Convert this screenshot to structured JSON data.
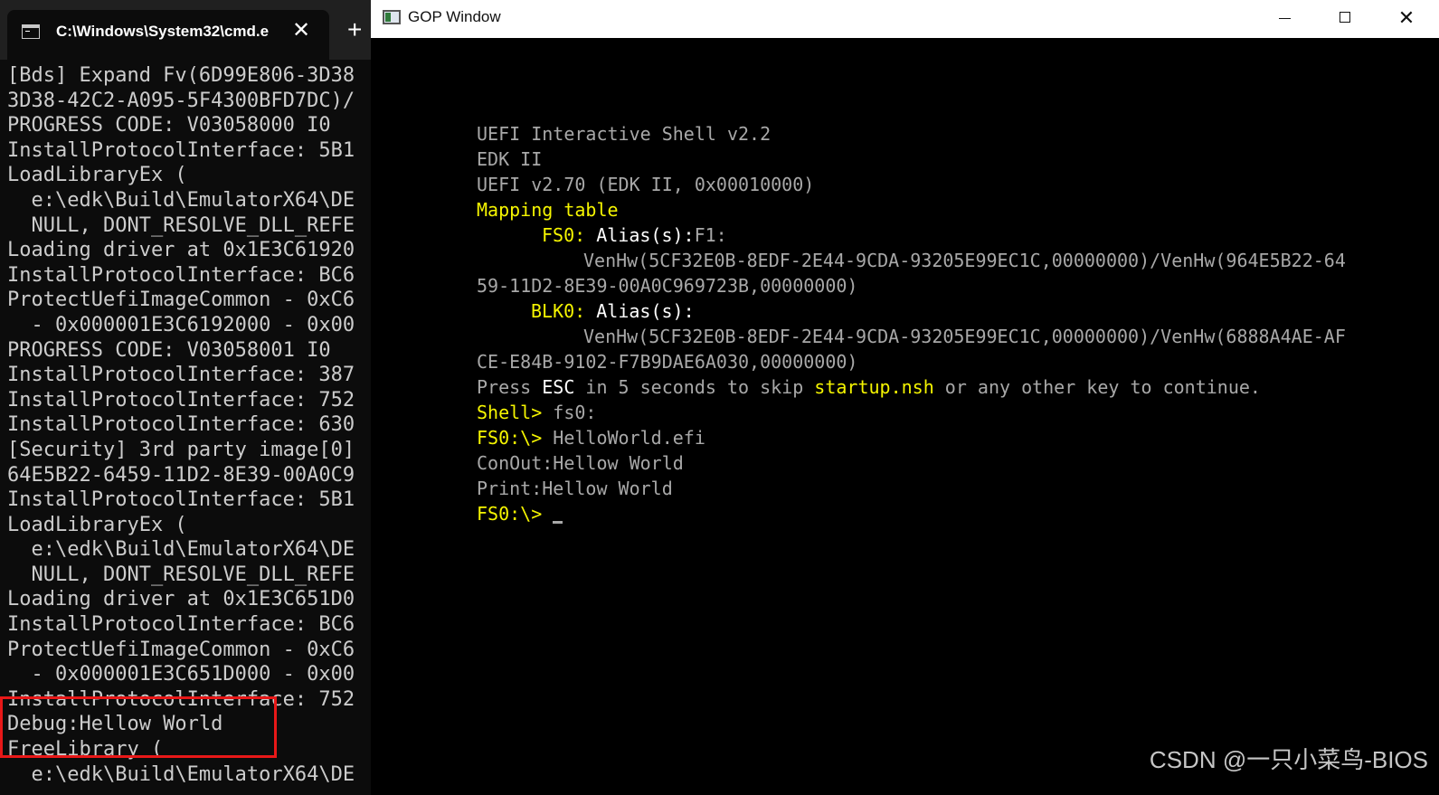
{
  "cmd_window": {
    "tab_title": "C:\\Windows\\System32\\cmd.e",
    "close_glyph": "✕",
    "new_tab_glyph": "+",
    "lines": [
      "[Bds] Expand Fv(6D99E806-3D38",
      "3D38-42C2-A095-5F4300BFD7DC)/",
      "PROGRESS CODE: V03058000 I0",
      "InstallProtocolInterface: 5B1",
      "LoadLibraryEx (",
      "  e:\\edk\\Build\\EmulatorX64\\DE",
      "  NULL, DONT_RESOLVE_DLL_REFE",
      "Loading driver at 0x1E3C61920",
      "InstallProtocolInterface: BC6",
      "ProtectUefiImageCommon - 0xC6",
      "  - 0x000001E3C6192000 - 0x00",
      "PROGRESS CODE: V03058001 I0",
      "InstallProtocolInterface: 387",
      "InstallProtocolInterface: 752",
      "InstallProtocolInterface: 630",
      "[Security] 3rd party image[0]",
      "64E5B22-6459-11D2-8E39-00A0C9",
      "InstallProtocolInterface: 5B1",
      "LoadLibraryEx (",
      "  e:\\edk\\Build\\EmulatorX64\\DE",
      "  NULL, DONT_RESOLVE_DLL_REFE",
      "Loading driver at 0x1E3C651D0",
      "InstallProtocolInterface: BC6",
      "ProtectUefiImageCommon - 0xC6",
      "  - 0x000001E3C651D000 - 0x00",
      "InstallProtocolInterface: 752",
      "Debug:Hellow World",
      "FreeLibrary (",
      "  e:\\edk\\Build\\EmulatorX64\\DE"
    ]
  },
  "gop_window": {
    "title": "GOP Window",
    "close_glyph": "✕",
    "shell": {
      "banner_1": "UEFI Interactive Shell v2.2",
      "banner_2": "EDK II",
      "banner_3": "UEFI v2.70 (EDK II, 0x00010000)",
      "mapping_title": "Mapping table",
      "fs0_label": "FS0:",
      "fs0_alias": "Alias(s):",
      "fs0_alias_value": "F1:",
      "fs0_path_1": "VenHw(5CF32E0B-8EDF-2E44-9CDA-93205E99EC1C,00000000)/VenHw(964E5B22-64",
      "fs0_path_2": "59-11D2-8E39-00A0C969723B,00000000)",
      "blk0_label": "BLK0:",
      "blk0_alias": "Alias(s):",
      "blk0_path_1": "VenHw(5CF32E0B-8EDF-2E44-9CDA-93205E99EC1C,00000000)/VenHw(6888A4AE-AF",
      "blk0_path_2": "CE-E84B-9102-F7B9DAE6A030,00000000)",
      "press_1": "Press ",
      "press_esc": "ESC",
      "press_2": " in 5 seconds to skip ",
      "press_startup": "startup.nsh",
      "press_3": " or any other key to continue.",
      "shell_prompt": "Shell>",
      "shell_cmd": " fs0:",
      "fs0_prompt_1": "FS0:\\>",
      "fs0_cmd_1": " HelloWorld.efi",
      "out_conout": "ConOut:Hellow World",
      "out_print": "Print:Hellow World",
      "fs0_prompt_2": "FS0:\\>"
    }
  },
  "watermark": "CSDN @一只小菜鸟-BIOS",
  "colors": {
    "cmd_background": "#0c0c0c",
    "cmd_text": "#cccccc",
    "shell_yellow": "#f5f500",
    "shell_gray": "#a8a8a8",
    "shell_white": "#ffffff",
    "highlight_red": "#e81818"
  }
}
